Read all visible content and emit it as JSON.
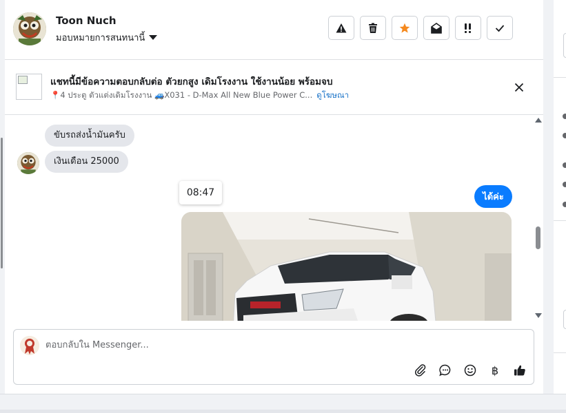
{
  "header": {
    "contact_name": "Toon Nuch",
    "assign_label": "มอบหมายการสนทนานี้",
    "actions": [
      "warning-icon",
      "trash-icon",
      "star-icon",
      "envelope-open-icon",
      "double-exclamation-icon",
      "check-icon"
    ]
  },
  "ad": {
    "title": "แชทนี้มีข้อความตอบกลับต่อ ตัวยกสูง เดิมโรงงาน ใช้งานน้อย พร้อมจบ",
    "subtitle": "📍4 ประตู ตัวแต่งเดิมโรงงาน 🚙X031 - D-Max All New Blue Power C...",
    "link": "ดูโฆษณา"
  },
  "messages": {
    "incoming_1": "ขับรถส่งน้ำมันครับ",
    "incoming_2": "เงินเดือน 25000",
    "timestamp": "08:47",
    "outgoing_1": "ได้ค่ะ"
  },
  "composer": {
    "placeholder": "ตอบกลับใน Messenger...",
    "tools": [
      "paperclip-icon",
      "chat-bubble-icon",
      "smiley-icon",
      "baht-icon",
      "thumbs-up-icon"
    ],
    "baht_symbol": "฿"
  },
  "colors": {
    "accent": "#0a7cff",
    "star": "#f5891f",
    "link": "#1a73c8"
  }
}
